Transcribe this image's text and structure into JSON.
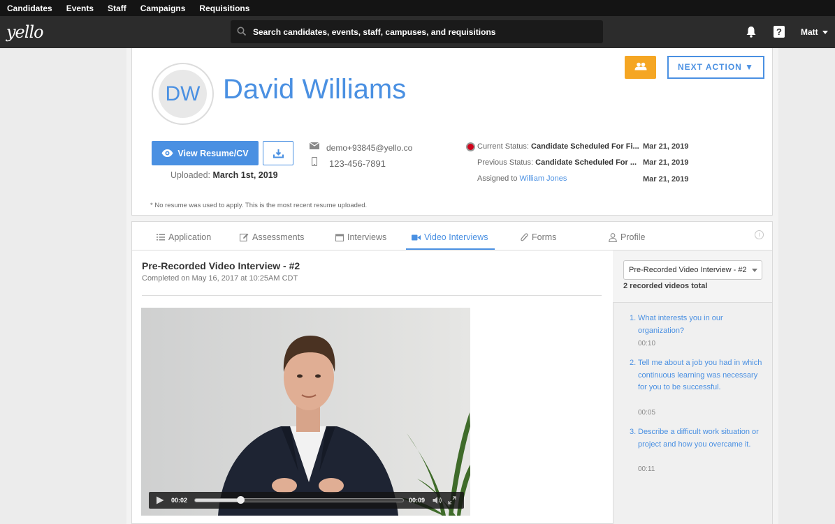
{
  "topnav": {
    "items": [
      "Candidates",
      "Events",
      "Staff",
      "Campaigns",
      "Requisitions"
    ]
  },
  "header": {
    "logo": "yello",
    "search_placeholder": "Search candidates, events, staff, campuses, and requisitions",
    "user": "Matt"
  },
  "candidate": {
    "initials": "DW",
    "name": "David Williams",
    "email": "demo+93845@yello.co",
    "phone": "123-456-7891"
  },
  "actions": {
    "next_action": "NEXT ACTION ▼",
    "view_resume": "View Resume/CV"
  },
  "resume": {
    "uploaded_label": "Uploaded:",
    "uploaded_date": "March 1st, 2019",
    "note": "* No resume was used to apply. This is the most recent resume uploaded."
  },
  "status": {
    "current_label": "Current Status:",
    "current_value": "Candidate Scheduled For Fi...",
    "current_date": "Mar 21, 2019",
    "previous_label": "Previous Status:",
    "previous_value": "Candidate Scheduled For ...",
    "previous_date": "Mar 21, 2019",
    "assigned_label": "Assigned to",
    "assigned_value": "William Jones",
    "assigned_date": "Mar 21, 2019",
    "colors": {
      "current": "#d0021b"
    }
  },
  "tabs": [
    {
      "label": "Application",
      "icon": "list-icon"
    },
    {
      "label": "Assessments",
      "icon": "edit-icon"
    },
    {
      "label": "Interviews",
      "icon": "calendar-icon"
    },
    {
      "label": "Video Interviews",
      "icon": "video-camera-icon",
      "active": true
    },
    {
      "label": "Forms",
      "icon": "paperclip-icon"
    },
    {
      "label": "Profile",
      "icon": "person-icon"
    }
  ],
  "interview": {
    "title": "Pre-Recorded Video Interview - #2",
    "completed": "Completed on May 16, 2017 at 10:25AM CDT",
    "player": {
      "current_time": "00:02",
      "duration": "00:09",
      "progress": 0.22
    }
  },
  "sidebar": {
    "select_value": "Pre-Recorded Video Interview - #2",
    "total": "2 recorded videos total",
    "questions": [
      {
        "num": "1.",
        "text": "What interests you in our organization?",
        "time": "00:10"
      },
      {
        "num": "2.",
        "text": "Tell me about a job you had in which continuous learning was necessary for you to be successful.",
        "time": "00:05"
      },
      {
        "num": "3.",
        "text": "Describe a difficult work situation or project and how you overcame it.",
        "time": "00:11"
      }
    ]
  },
  "colors": {
    "accent": "#4a90e2",
    "team_button": "#f5a623",
    "topbar": "#141414",
    "header": "#2c2c2c"
  }
}
